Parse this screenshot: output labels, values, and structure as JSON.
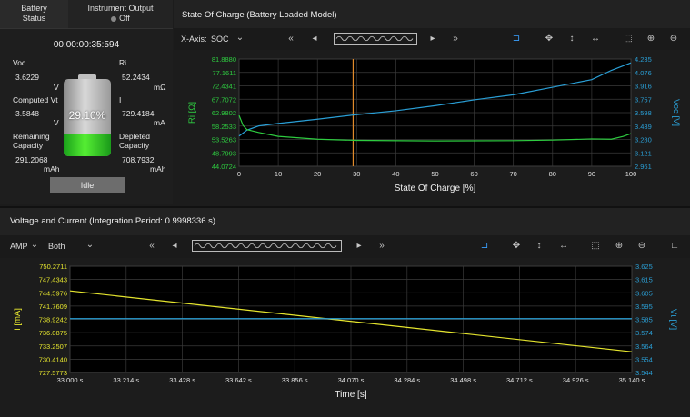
{
  "left_panel": {
    "tabs": {
      "battery_status": [
        "Battery",
        "Status"
      ],
      "instrument_output": "Instrument Output",
      "output_state": "Off"
    },
    "timer": "00:00:00:35:594",
    "voc_label": "Voc",
    "voc_value": "3.6229",
    "voc_unit": "V",
    "ri_label": "Ri",
    "ri_value": "52.2434",
    "ri_unit": "mΩ",
    "computed_vt_label": "Computed Vt",
    "computed_vt_value": "3.5848",
    "computed_vt_unit": "V",
    "i_label": "I",
    "i_value": "729.4184",
    "i_unit": "mA",
    "remaining_label": [
      "Remaining",
      "Capacity"
    ],
    "remaining_value": "291.2068",
    "remaining_unit": "mAh",
    "depleted_label": [
      "Depleted",
      "Capacity"
    ],
    "depleted_value": "708.7932",
    "depleted_unit": "mAh",
    "battery_percent_text": "29.10%",
    "battery_fraction": 0.291,
    "status_button": "Idle"
  },
  "soc_panel": {
    "title": "State Of Charge (Battery Loaded Model)",
    "xaxis_label": "X-Axis:",
    "xaxis_value": "SOC",
    "icons": [
      "rewind-icon",
      "step-back-icon",
      "play-icon",
      "fast-forward-icon",
      "bracket-icon",
      "move-icon",
      "vertical-pan-icon",
      "horizontal-pan-icon",
      "zoom-select-icon",
      "zoom-in-icon",
      "zoom-out-icon"
    ]
  },
  "vi_panel": {
    "title": "Voltage and Current (Integration Period: 0.9998336 s)",
    "amp_label": "AMP",
    "mode_value": "Both"
  },
  "chart_data": [
    {
      "type": "line",
      "xlabel": "State Of Charge [%]",
      "ylabel_left": "Ri [Ω]",
      "ylabel_right": "Voc [V]",
      "x_ticks": [
        "0",
        "10",
        "20",
        "30",
        "40",
        "50",
        "60",
        "70",
        "80",
        "90",
        "100"
      ],
      "y_left_ticks": [
        "81.8880",
        "77.1611",
        "72.4341",
        "67.7072",
        "62.9802",
        "58.2533",
        "53.5263",
        "48.7993",
        "44.0724"
      ],
      "y_right_ticks": [
        "4.235",
        "4.076",
        "3.916",
        "3.757",
        "3.598",
        "3.439",
        "3.280",
        "3.121",
        "2.961"
      ],
      "xlim": [
        0,
        100
      ],
      "ylim_left": [
        44.0724,
        81.888
      ],
      "ylim_right": [
        2.961,
        4.235
      ],
      "marker_x": 29.1,
      "colors": {
        "ri": "#2ecc40",
        "voc": "#2a9fd6",
        "marker": "#e08a2a"
      },
      "series": [
        {
          "axis": "right",
          "x": [
            0,
            2,
            5,
            10,
            20,
            29.1,
            40,
            50,
            60,
            70,
            80,
            90,
            95,
            100
          ],
          "values": [
            3.32,
            3.39,
            3.44,
            3.47,
            3.52,
            3.57,
            3.62,
            3.68,
            3.75,
            3.81,
            3.9,
            3.99,
            4.1,
            4.19
          ]
        },
        {
          "axis": "left",
          "x": [
            0,
            1,
            2,
            5,
            10,
            20,
            30,
            50,
            70,
            80,
            90,
            95,
            98,
            100
          ],
          "values": [
            62.0,
            58.5,
            57.0,
            56.0,
            54.6,
            53.6,
            53.2,
            53.0,
            53.1,
            53.3,
            53.7,
            53.6,
            54.6,
            55.6
          ]
        }
      ]
    },
    {
      "type": "line",
      "xlabel": "Time [s]",
      "ylabel_left": "I [mA]",
      "ylabel_right": "Vt [V]",
      "x_ticks": [
        "33.000 s",
        "33.214 s",
        "33.428 s",
        "33.642 s",
        "33.856 s",
        "34.070 s",
        "34.284 s",
        "34.498 s",
        "34.712 s",
        "34.926 s",
        "35.140 s"
      ],
      "y_left_ticks": [
        "750.2711",
        "747.4343",
        "744.5976",
        "741.7609",
        "738.9242",
        "736.0875",
        "733.2507",
        "730.4140",
        "727.5773"
      ],
      "y_right_ticks": [
        "3.625",
        "3.615",
        "3.605",
        "3.595",
        "3.585",
        "3.574",
        "3.564",
        "3.554",
        "3.544"
      ],
      "xlim": [
        33.0,
        35.14
      ],
      "ylim_left": [
        727.5773,
        750.2711
      ],
      "ylim_right": [
        3.544,
        3.625
      ],
      "colors": {
        "current": "#e5e52e",
        "voltage": "#2a9fd6"
      },
      "series": [
        {
          "axis": "left",
          "x": [
            33.0,
            35.14
          ],
          "values": [
            745.0,
            732.0
          ]
        },
        {
          "axis": "right",
          "x": [
            33.0,
            35.14
          ],
          "values": [
            3.585,
            3.585
          ]
        }
      ]
    }
  ]
}
